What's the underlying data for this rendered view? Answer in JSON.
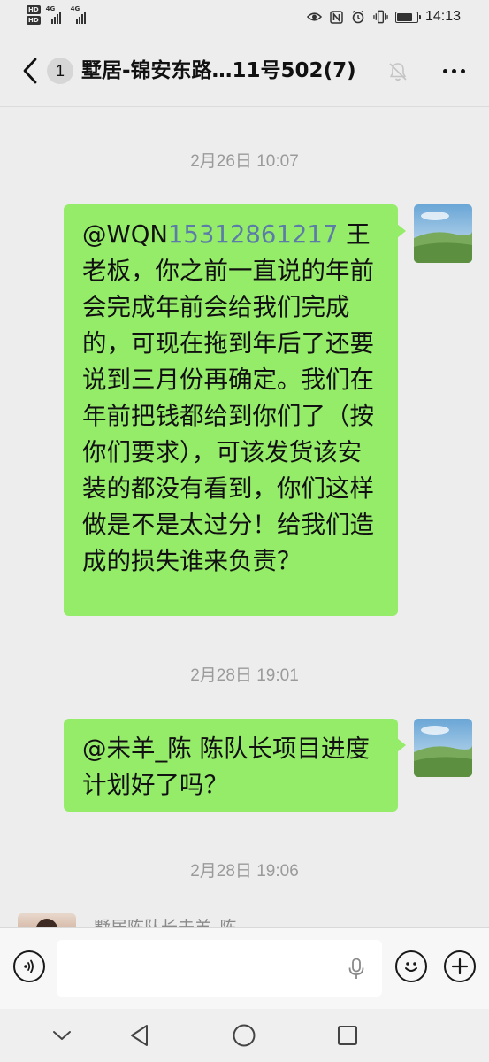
{
  "status_bar": {
    "hd_labels": [
      "HD",
      "HD"
    ],
    "network": [
      "4G",
      "4G"
    ],
    "time": "14:13",
    "battery_level": 0.8
  },
  "header": {
    "unread_count": "1",
    "title": "墅居-锦安东路…11号502(7)"
  },
  "messages": [
    {
      "timestamp": "2月26日 10:07",
      "mention_prefix": "@WQN",
      "mention_number": "15312861217",
      "text": " 王老板，你之前一直说的年前会完成年前会给我们完成的，可现在拖到年后了还要说到三月份再确定。我们在年前把钱都给到你们了（按你们要求），可该发货该安装的都没有看到，你们这样做是不是太过分！给我们造成的损失谁来负责？"
    },
    {
      "timestamp": "2月28日 19:01",
      "text": "@未羊_陈 陈队长项目进度计划好了吗？"
    }
  ],
  "last_timestamp": "2月28日 19:06",
  "peek_sender_name": "墅居陈队长未羊_陈",
  "input": {
    "value": "",
    "placeholder": ""
  },
  "colors": {
    "background": "#ededed",
    "bubble_outgoing": "#95ec69",
    "mention_number": "#5b7ba8",
    "timestamp": "#9a9a9a"
  },
  "icons": [
    "back-icon",
    "mute-icon",
    "more-icon",
    "voice-icon",
    "mic-icon",
    "emoji-icon",
    "plus-icon",
    "nav-down-icon",
    "nav-back-icon",
    "nav-home-icon",
    "nav-recent-icon"
  ]
}
